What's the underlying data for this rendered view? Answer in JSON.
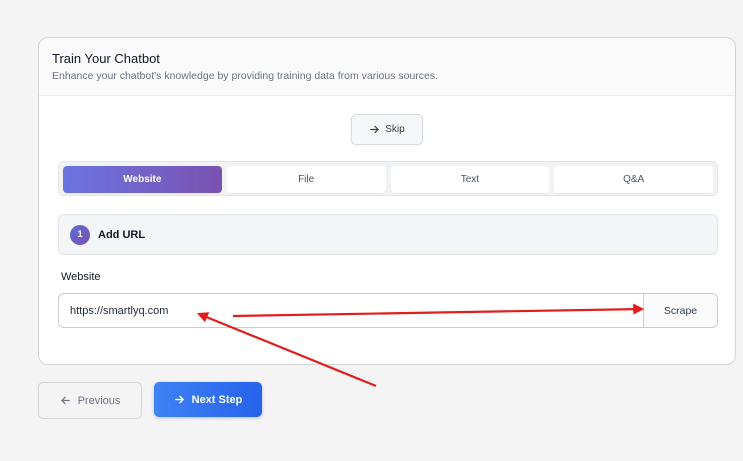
{
  "card": {
    "title": "Train Your Chatbot",
    "subtitle": "Enhance your chatbot's knowledge by providing training data from various sources."
  },
  "skip": {
    "label": "Skip",
    "icon": "arrow-right-icon"
  },
  "tabs": [
    {
      "label": "Website",
      "active": true
    },
    {
      "label": "File",
      "active": false
    },
    {
      "label": "Text",
      "active": false
    },
    {
      "label": "Q&A",
      "active": false
    }
  ],
  "step": {
    "number": "1",
    "label": "Add URL"
  },
  "website": {
    "label": "Website",
    "value": "https://smartlyq.com",
    "scrape_label": "Scrape"
  },
  "nav": {
    "previous_label": "Previous",
    "previous_icon": "arrow-left-icon",
    "next_label": "Next Step",
    "next_icon": "arrow-right-icon"
  },
  "colors": {
    "tab_active_start": "#6b74e0",
    "tab_active_end": "#7a52b0",
    "primary_button": "#2563eb",
    "annotation_arrow": "#e11d1d"
  }
}
